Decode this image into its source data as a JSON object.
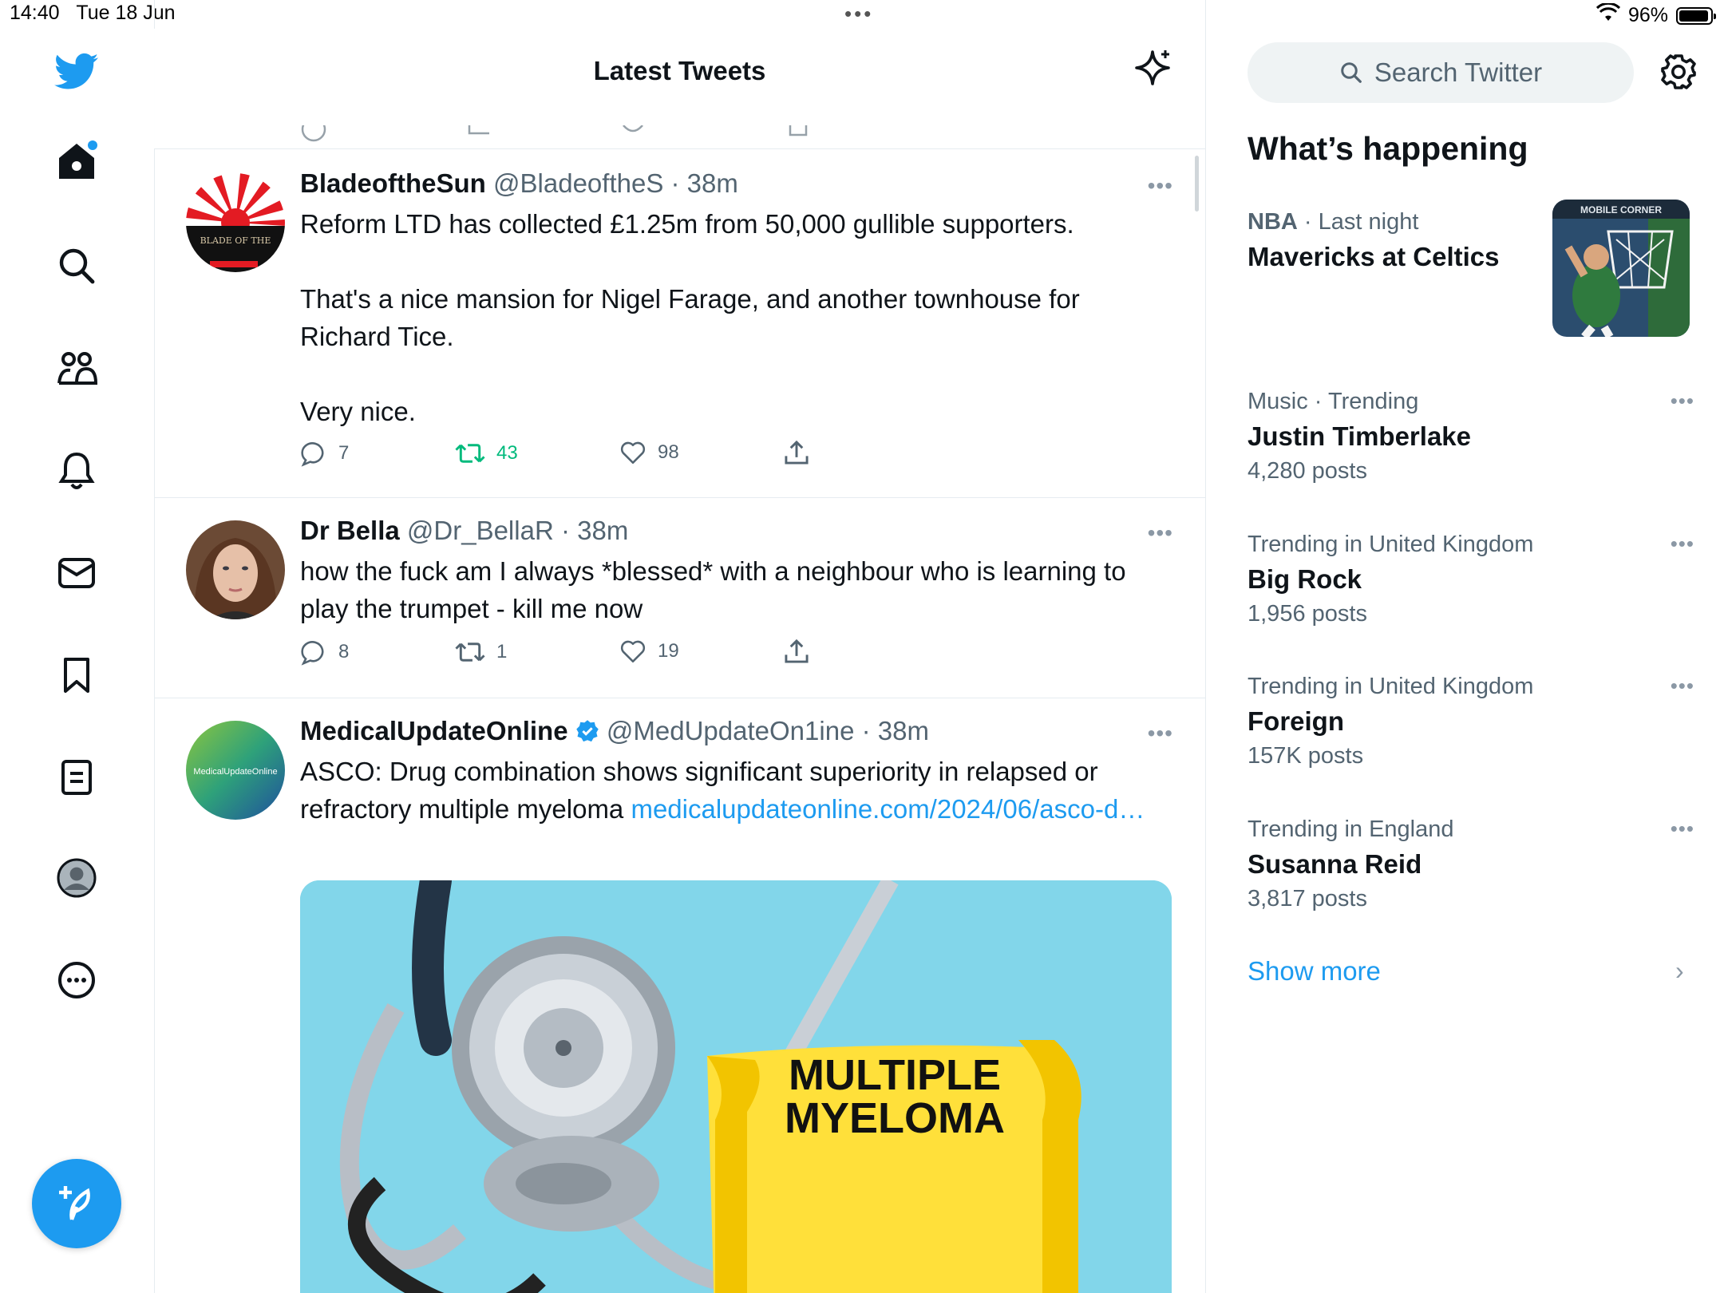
{
  "status_bar": {
    "time": "14:40",
    "date": "Tue 18 Jun",
    "battery": "96%",
    "battery_level": 0.96,
    "wifi_icon": "wifi-icon"
  },
  "nav": {
    "items": [
      "twitter-logo",
      "home",
      "search",
      "communities",
      "notifications",
      "messages",
      "bookmarks",
      "lists",
      "profile",
      "more"
    ],
    "compose_icon": "compose-feather-icon"
  },
  "feed": {
    "title": "Latest Tweets",
    "tweets": [
      {
        "name": "BladeoftheSun",
        "handle": "@BladeoftheS",
        "time": "38m",
        "text": "Reform LTD has collected £1.25m from 50,000 gullible supporters.\n\nThat's a nice mansion for Nigel Farage, and another townhouse for Richard Tice.\n\nVery nice.",
        "avatar_text": "BLADE OF THE",
        "replies": "7",
        "retweets": "43",
        "likes": "98",
        "retweeted": true
      },
      {
        "name": "Dr Bella",
        "handle": "@Dr_BellaR",
        "time": "38m",
        "text": "how the fuck am I always *blessed* with a neighbour who is learning to play the trumpet - kill me now",
        "replies": "8",
        "retweets": "1",
        "likes": "19"
      },
      {
        "name": "MedicalUpdateOnline",
        "handle": "@MedUpdateOn1ine",
        "time": "38m",
        "verified": true,
        "avatar_text": "MedicalUpdateOnline",
        "text": "ASCO: Drug combination shows significant superiority in relapsed or refractory multiple myeloma ",
        "link": "medicalupdateonline.com/2024/06/asco-d…",
        "media_text_1": "MULTIPLE",
        "media_text_2": "MYELOMA"
      }
    ]
  },
  "sidebar": {
    "search_placeholder": "Search Twitter",
    "section_title": "What’s happening",
    "trends": [
      {
        "context": "NBA",
        "context_sep": " · ",
        "context_extra": "Last night",
        "name": "Mavericks at Celtics",
        "image_text": "MOBILE CORNER"
      },
      {
        "context": "Music · Trending",
        "name": "Justin Timberlake",
        "count": "4,280 posts"
      },
      {
        "context": "Trending in United Kingdom",
        "name": "Big Rock",
        "count": "1,956 posts"
      },
      {
        "context": "Trending in United Kingdom",
        "name": "Foreign",
        "count": "157K posts"
      },
      {
        "context": "Trending in England",
        "name": "Susanna Reid",
        "count": "3,817 posts"
      }
    ],
    "show_more": "Show more"
  },
  "colors": {
    "accent": "#1d9bf0",
    "retweet_green": "#00ba7c",
    "text_secondary": "#536471"
  }
}
